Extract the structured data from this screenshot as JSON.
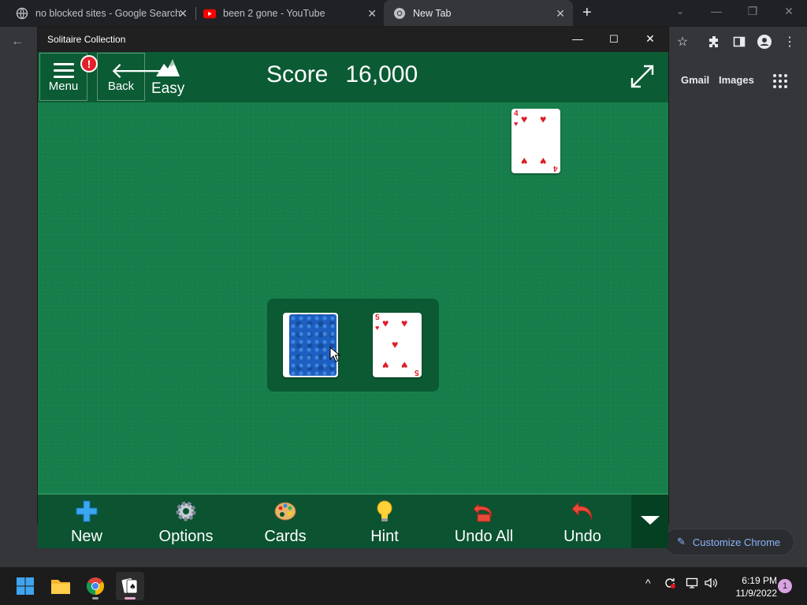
{
  "browser": {
    "tabs": [
      {
        "title": "no blocked sites - Google Search",
        "icon": "globe-icon"
      },
      {
        "title": "been 2 gone - YouTube",
        "icon": "youtube-icon"
      },
      {
        "title": "New Tab",
        "icon": "chrome-icon"
      }
    ],
    "new_tab_symbol": "+",
    "ntp_links": {
      "gmail": "Gmail",
      "images": "Images"
    },
    "customize_label": "Customize Chrome"
  },
  "solitaire": {
    "window_title": "Solitaire Collection",
    "menu_label": "Menu",
    "menu_badge": "!",
    "back_label": "Back",
    "difficulty": "Easy",
    "score_label": "Score",
    "score_value": "16,000",
    "foundation_card": {
      "rank": "4",
      "suit": "hearts",
      "symbol": "♥"
    },
    "waste_card": {
      "rank": "5",
      "suit": "hearts",
      "symbol": "♥"
    },
    "toolbar": [
      {
        "label": "New",
        "icon": "plus-icon"
      },
      {
        "label": "Options",
        "icon": "gear-icon"
      },
      {
        "label": "Cards",
        "icon": "palette-icon"
      },
      {
        "label": "Hint",
        "icon": "lightbulb-icon"
      },
      {
        "label": "Undo All",
        "icon": "undo-all-icon"
      },
      {
        "label": "Undo",
        "icon": "undo-icon"
      }
    ]
  },
  "taskbar": {
    "apps": [
      "start",
      "file-explorer",
      "chrome",
      "solitaire"
    ],
    "time": "6:19 PM",
    "date": "11/9/2022",
    "notification_count": "1"
  },
  "colors": {
    "felt": "#167e4a",
    "felt_dark": "#0b5b34",
    "card_red": "#e01c26",
    "card_back": "#1d5fc0",
    "chrome_dark": "#202124",
    "chrome_toolbar": "#35363a",
    "link_blue": "#8ab4f8"
  }
}
